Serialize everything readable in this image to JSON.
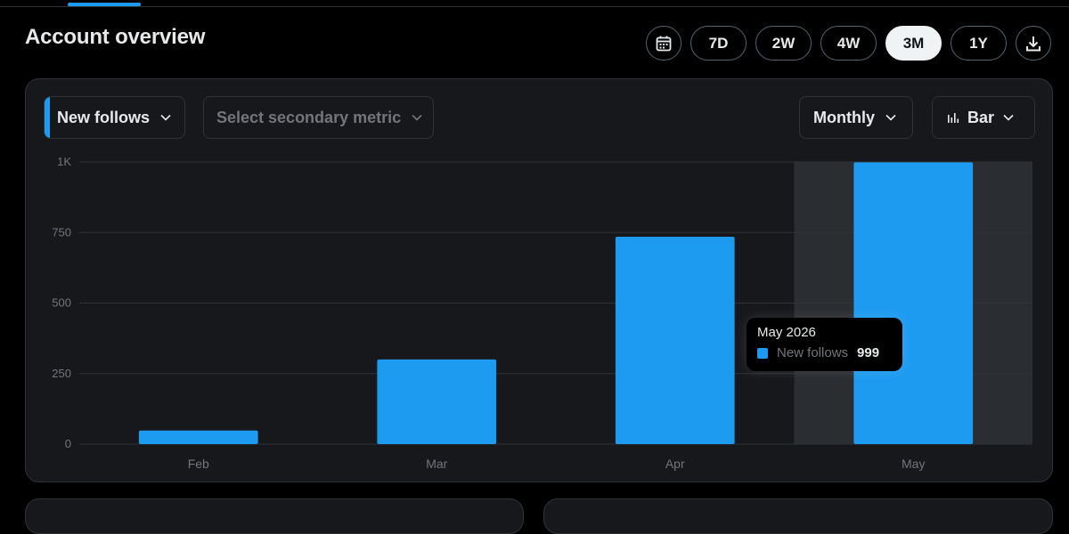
{
  "header": {
    "title": "Account overview",
    "ranges": [
      {
        "label": "7D",
        "active": false
      },
      {
        "label": "2W",
        "active": false
      },
      {
        "label": "4W",
        "active": false
      },
      {
        "label": "3M",
        "active": true
      },
      {
        "label": "1Y",
        "active": false
      }
    ],
    "calendar_icon": "calendar-icon",
    "download_icon": "download-icon"
  },
  "controls": {
    "primary_metric": "New follows",
    "secondary_metric_placeholder": "Select secondary metric",
    "granularity": "Monthly",
    "chart_type": "Bar",
    "chart_type_icon": "bar-chart-icon",
    "chevron_icon": "chevron-down-icon"
  },
  "colors": {
    "accent": "#1d9bf0",
    "highlight": "#2a2d31"
  },
  "chart_data": {
    "type": "bar",
    "categories": [
      "Feb",
      "Mar",
      "Apr",
      "May"
    ],
    "series": [
      {
        "name": "New follows",
        "values": [
          48,
          300,
          735,
          999
        ]
      }
    ],
    "ylim": [
      0,
      1000
    ],
    "yticks": [
      0,
      250,
      500,
      750,
      1000
    ],
    "ytick_labels": [
      "0",
      "250",
      "500",
      "750",
      "1K"
    ],
    "grid": true,
    "highlighted_category": "May"
  },
  "tooltip": {
    "title": "May 2026",
    "label": "New follows",
    "value": "999"
  }
}
